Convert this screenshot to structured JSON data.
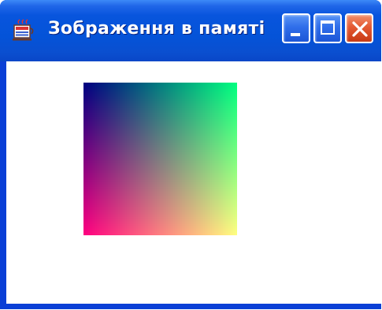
{
  "window": {
    "title": "Зображення в памяті",
    "app_icon": "java-cup-icon",
    "buttons": {
      "minimize": "minimize-icon",
      "maximize": "maximize-icon",
      "close": "close-icon"
    }
  },
  "canvas": {
    "image_type": "color-gradient",
    "corner_colors": {
      "top_left": "#000080",
      "top_right": "#00ff80",
      "bottom_left": "#ff0080",
      "bottom_right": "#ffff80"
    }
  },
  "colors": {
    "frame": "#0a3fd6",
    "close_button": "#e45a33"
  }
}
